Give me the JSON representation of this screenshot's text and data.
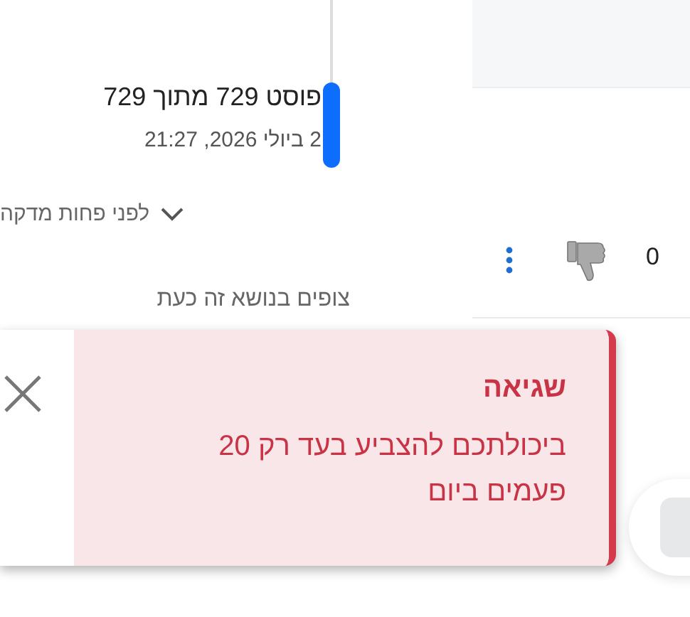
{
  "timeline": {
    "position_label": "פוסט 729 מתוך 729",
    "date": "2 ביולי 2026, 21:27",
    "recent_label": "לפני פחות מדקה"
  },
  "watchers_label": "צופים בנושא זה כעת",
  "post": {
    "dislike_count": "0"
  },
  "toast": {
    "kind": "error",
    "title": "שגיאה",
    "message": "ביכולתכם להצביע בעד רק 20 פעמים ביום"
  }
}
